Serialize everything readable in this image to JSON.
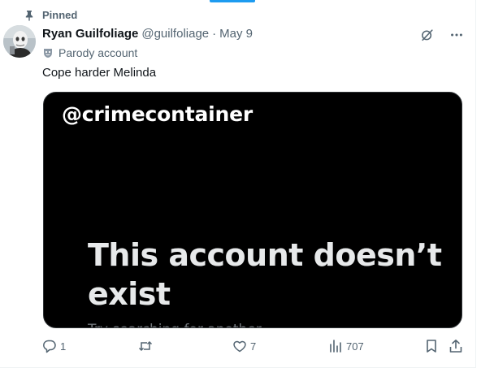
{
  "pinned": {
    "label": "Pinned"
  },
  "tweet": {
    "display_name": "Ryan Guilfoliage",
    "handle": "@guilfoliage",
    "separator": "·",
    "date": "May 9",
    "parody_label": "Parody account",
    "text": "Cope harder Melinda"
  },
  "media": {
    "handle": "@crimecontainer",
    "headline": "This account doesn’t exist",
    "subtext": "Try searching for another."
  },
  "actions": {
    "replies": "1",
    "retweets": "",
    "likes": "7",
    "views": "707"
  },
  "icons": {
    "pin": "pin-icon",
    "grok": "grok-icon",
    "more": "more-icon",
    "parody": "parody-mask-icon",
    "reply": "reply-icon",
    "retweet": "retweet-icon",
    "like": "heart-icon",
    "views": "views-chart-icon",
    "bookmark": "bookmark-icon",
    "share": "share-icon"
  },
  "colors": {
    "accent": "#1d9bf0",
    "text": "#0f1419",
    "muted": "#536471",
    "media_bg": "#000000"
  }
}
